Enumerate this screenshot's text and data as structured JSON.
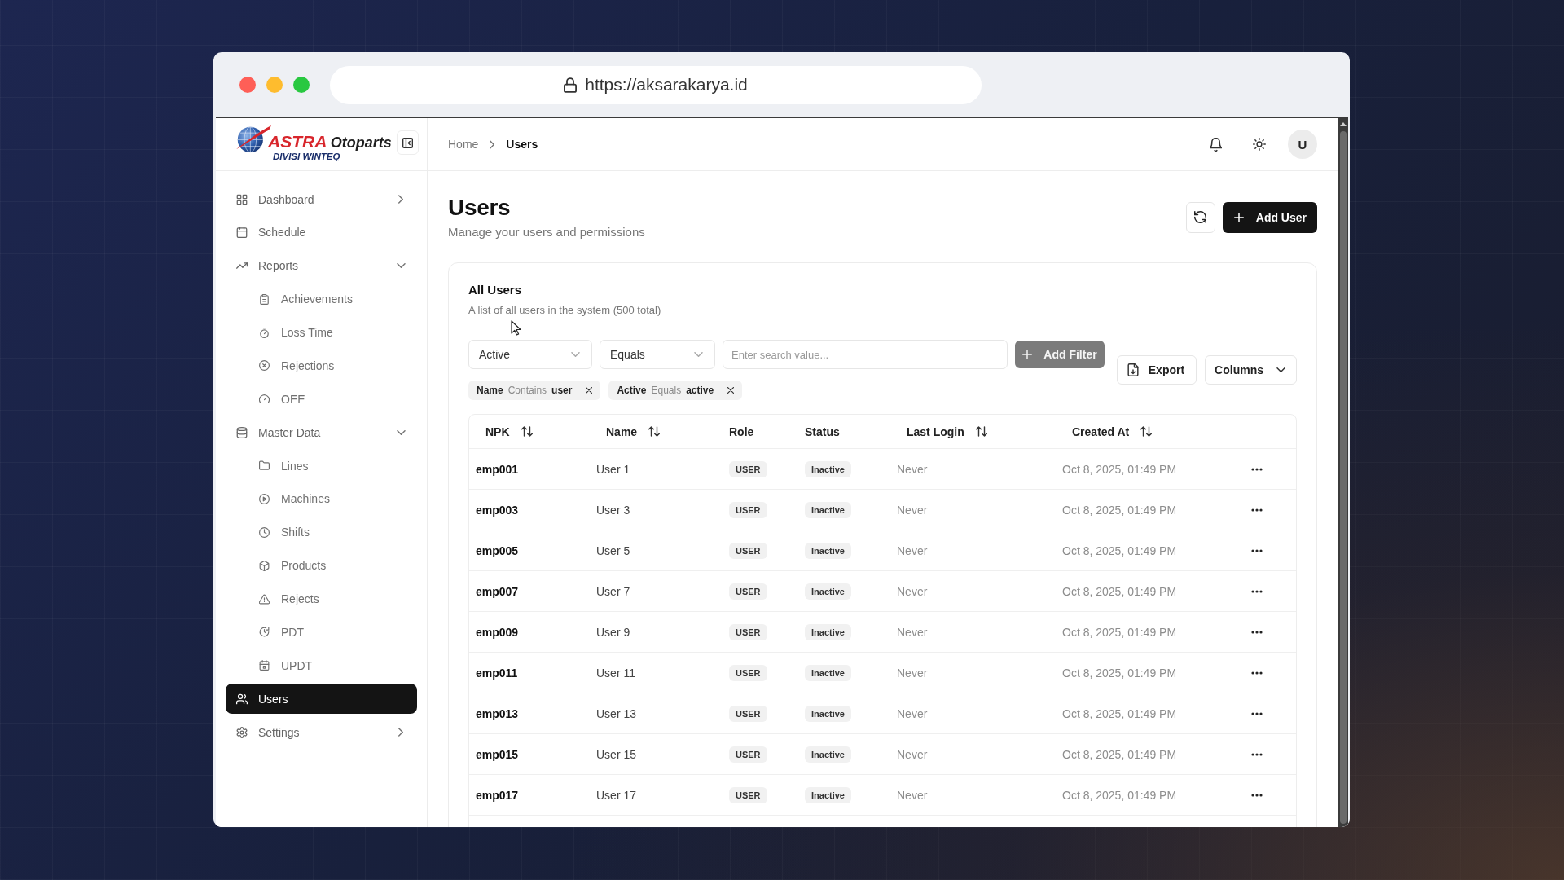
{
  "browser": {
    "url": "https://aksarakarya.id"
  },
  "sidebar": {
    "logo": {
      "brand": "ASTRA",
      "name": "Otoparts",
      "division": "DIVISI WINTEQ"
    },
    "items": [
      {
        "label": "Dashboard",
        "kind": "group",
        "expanded": false,
        "selected": false
      },
      {
        "label": "Schedule",
        "kind": "link",
        "selected": false
      },
      {
        "label": "Reports",
        "kind": "group",
        "expanded": true,
        "selected": false,
        "children": [
          {
            "label": "Achievements",
            "selected": false
          },
          {
            "label": "Loss Time",
            "selected": false
          },
          {
            "label": "Rejections",
            "selected": false
          },
          {
            "label": "OEE",
            "selected": false
          }
        ]
      },
      {
        "label": "Master Data",
        "kind": "group",
        "expanded": true,
        "selected": false,
        "children": [
          {
            "label": "Lines",
            "selected": false
          },
          {
            "label": "Machines",
            "selected": false
          },
          {
            "label": "Shifts",
            "selected": false
          },
          {
            "label": "Products",
            "selected": false
          },
          {
            "label": "Rejects",
            "selected": false
          },
          {
            "label": "PDT",
            "selected": false
          },
          {
            "label": "UPDT",
            "selected": false
          }
        ]
      },
      {
        "label": "Users",
        "kind": "link",
        "selected": true
      },
      {
        "label": "Settings",
        "kind": "group",
        "expanded": false,
        "selected": false
      }
    ]
  },
  "header": {
    "breadcrumb": [
      {
        "label": "Home",
        "current": false
      },
      {
        "label": "Users",
        "current": true
      }
    ],
    "avatar": "U"
  },
  "page": {
    "title": "Users",
    "subtitle": "Manage your users and permissions",
    "add_button": "Add User"
  },
  "card": {
    "title": "All Users",
    "description": "A list of all users in the system (500 total)"
  },
  "filters": {
    "field": "Active",
    "operator": "Equals",
    "search": {
      "placeholder": "Enter search value..."
    },
    "add_filter": {
      "label": "Add Filter",
      "disabled": true
    },
    "chips": [
      {
        "field": "Name",
        "operator": "Contains",
        "value": "user"
      },
      {
        "field": "Active",
        "operator": "Equals",
        "value": "active"
      }
    ],
    "export": "Export",
    "columns": "Columns"
  },
  "table": {
    "columns": [
      {
        "label": "NPK",
        "sortable": true
      },
      {
        "label": "Name",
        "sortable": true
      },
      {
        "label": "Role",
        "sortable": false
      },
      {
        "label": "Status",
        "sortable": false
      },
      {
        "label": "Last Login",
        "sortable": true
      },
      {
        "label": "Created At",
        "sortable": true
      }
    ],
    "rows": [
      {
        "npk": "emp001",
        "name": "User 1",
        "role": "USER",
        "status": "Inactive",
        "last_login": "Never",
        "created_at": "Oct 8, 2025, 01:49 PM"
      },
      {
        "npk": "emp003",
        "name": "User 3",
        "role": "USER",
        "status": "Inactive",
        "last_login": "Never",
        "created_at": "Oct 8, 2025, 01:49 PM"
      },
      {
        "npk": "emp005",
        "name": "User 5",
        "role": "USER",
        "status": "Inactive",
        "last_login": "Never",
        "created_at": "Oct 8, 2025, 01:49 PM"
      },
      {
        "npk": "emp007",
        "name": "User 7",
        "role": "USER",
        "status": "Inactive",
        "last_login": "Never",
        "created_at": "Oct 8, 2025, 01:49 PM"
      },
      {
        "npk": "emp009",
        "name": "User 9",
        "role": "USER",
        "status": "Inactive",
        "last_login": "Never",
        "created_at": "Oct 8, 2025, 01:49 PM"
      },
      {
        "npk": "emp011",
        "name": "User 11",
        "role": "USER",
        "status": "Inactive",
        "last_login": "Never",
        "created_at": "Oct 8, 2025, 01:49 PM"
      },
      {
        "npk": "emp013",
        "name": "User 13",
        "role": "USER",
        "status": "Inactive",
        "last_login": "Never",
        "created_at": "Oct 8, 2025, 01:49 PM"
      },
      {
        "npk": "emp015",
        "name": "User 15",
        "role": "USER",
        "status": "Inactive",
        "last_login": "Never",
        "created_at": "Oct 8, 2025, 01:49 PM"
      },
      {
        "npk": "emp017",
        "name": "User 17",
        "role": "USER",
        "status": "Inactive",
        "last_login": "Never",
        "created_at": "Oct 8, 2025, 01:49 PM"
      }
    ]
  }
}
